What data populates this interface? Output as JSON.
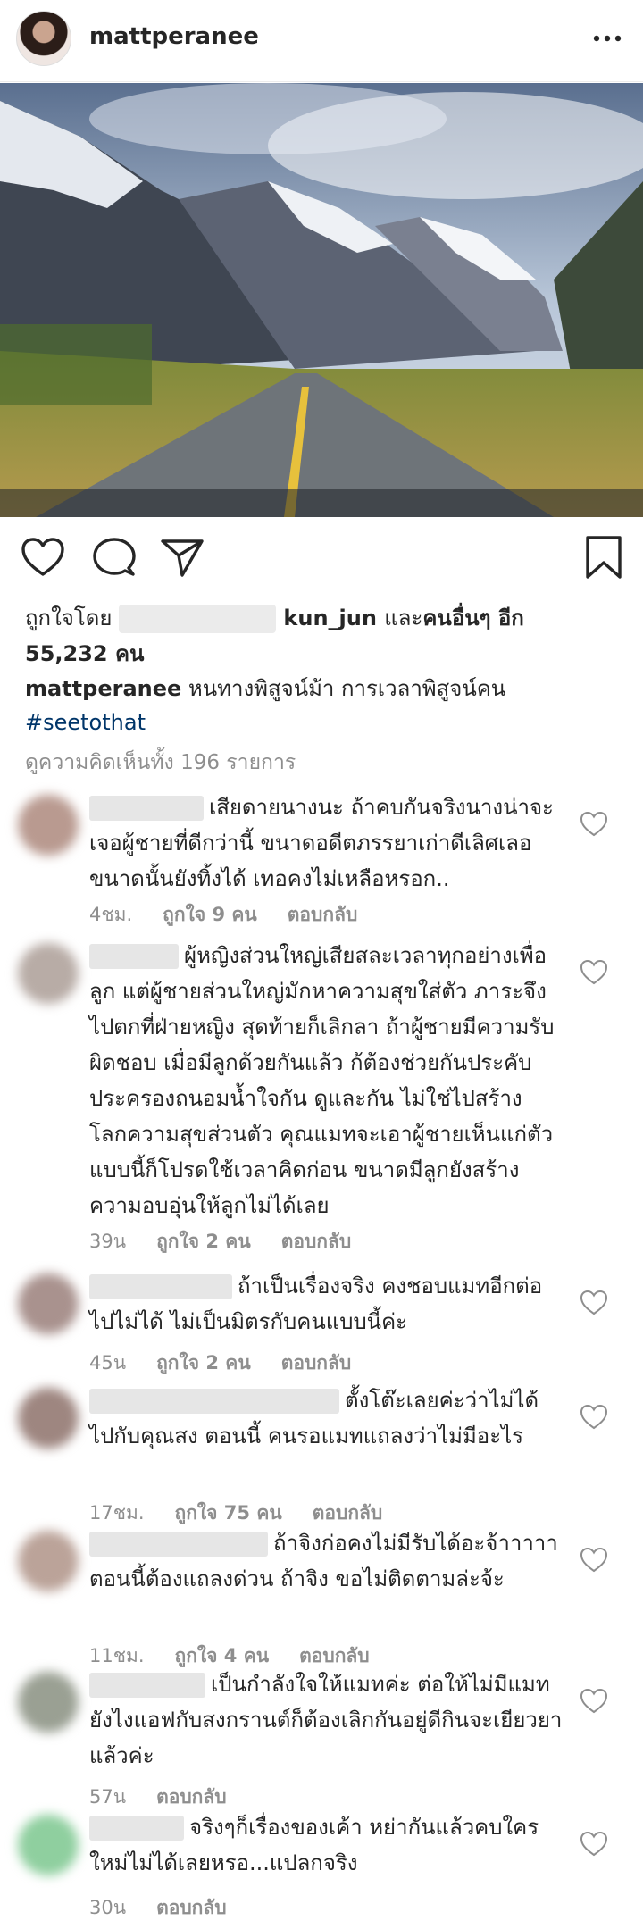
{
  "post": {
    "username": "mattperanee",
    "more_icon": "more-horizontal-icon"
  },
  "likes": {
    "prefix": "ถูกใจโดย",
    "name": "kun_jun",
    "connector": "และ",
    "others": "คนอื่นๆ อีก",
    "count": "55,232 คน"
  },
  "caption": {
    "username": "mattperanee",
    "text": "หนทางพิสูจน์ม้า การเวลาพิสูจน์คน",
    "hashtag": "#seetothat"
  },
  "view_all_comments": "ดูความคิดเห็นทั้ง 196 รายการ",
  "comment_labels": {
    "reply": "ตอบกลับ"
  },
  "comments": [
    {
      "text": "เสียดายนางนะ ถ้าคบกันจริงนางน่าจะเจอผู้ชายที่ดีกว่านี้ ขนาดอดีตภรรยาเก่าดีเลิศเลอขนาดนั้นยังทิ้งได้ เทอคงไม่เหลือหรอก..",
      "time": "4ชม.",
      "likes": "ถูกใจ 9 คน"
    },
    {
      "text": "ผู้หญิงส่วนใหญ่เสียสละเวลาทุกอย่างเพื่อลูก แต่ผู้ชายส่วนใหญ่มักหาความสุขใส่ตัว ภาระจึงไปตกที่ฝ่ายหญิง สุดท้ายก็เลิกลา ถ้าผู้ชายมีความรับผิดชอบ เมื่อมีลูกด้วยกันแล้ว ก้ต้องช่วยกันประคับประครองถนอมน้ำใจกัน ดูและกัน ไม่ใช่ไปสร้าง โลกความสุขส่วนตัว คุณแมทจะเอาผู้ชายเห็นแก่ตัวแบบนี้ก็โปรดใช้เวลาคิดก่อน ขนาดมีลูกยังสร้างความอบอุ่นให้ลูกไม่ได้เลย",
      "time": "39น",
      "likes": "ถูกใจ 2 คน"
    },
    {
      "text": "ถ้าเป็นเรื่องจริง คงชอบแมทอีกต่อไปไม่ได้ ไม่เป็นมิตรกับคนแบบนี้ค่ะ",
      "time": "45น",
      "likes": "ถูกใจ 2 คน"
    },
    {
      "text": "ตั้งโต๊ะเลยค่ะว่าไม่ได้ไปกับคุณสง ตอนนี้ คนรอแมทแถลงว่าไม่มีอะไร",
      "time": "17ชม.",
      "likes": "ถูกใจ 75 คน"
    },
    {
      "text": "ถ้าจิงก่อคงไม่มีรับได้อะจ้าาาาา ตอนนี้ต้องแถลงด่วน ถ้าจิง ขอไม่ติดตามล่ะจ้ะ",
      "time": "11ชม.",
      "likes": "ถูกใจ 4 คน"
    },
    {
      "text": "เป็นกำลังใจให้แมทค่ะ ต่อให้ไม่มีแมท ยังไงแอฟกับสงกรานต์ก็ต้องเลิกกันอยู่ดีกินจะเยียวยาแล้วค่ะ",
      "time": "57น",
      "likes": ""
    },
    {
      "text": "จริงๆก็เรื่องของเค้า หย่ากันแล้วคบใครใหม่ไม่ได้เลยหรอ...แปลกจริง",
      "time": "30น",
      "likes": ""
    }
  ],
  "icons": {
    "like": "heart-icon",
    "comment": "comment-icon",
    "share": "send-icon",
    "save": "bookmark-icon"
  }
}
